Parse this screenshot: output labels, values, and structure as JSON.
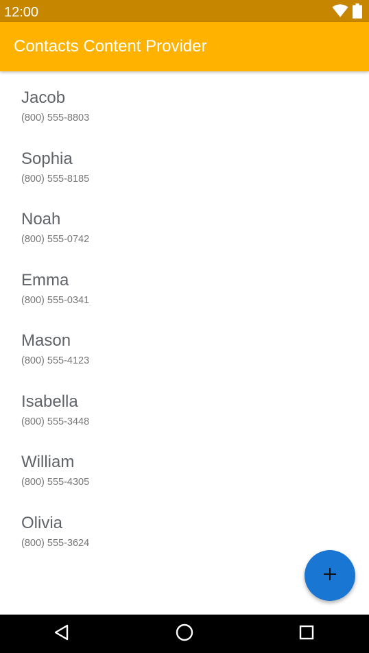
{
  "status_bar": {
    "time": "12:00",
    "icons": [
      "wifi-icon",
      "battery-icon"
    ],
    "color": "#C68600"
  },
  "app_bar": {
    "title": "Contacts Content Provider",
    "color": "#FFB300"
  },
  "contacts": [
    {
      "name": "Jacob",
      "phone": "(800) 555-8803"
    },
    {
      "name": "Sophia",
      "phone": "(800) 555-8185"
    },
    {
      "name": "Noah",
      "phone": "(800) 555-0742"
    },
    {
      "name": "Emma",
      "phone": "(800) 555-0341"
    },
    {
      "name": "Mason",
      "phone": "(800) 555-4123"
    },
    {
      "name": "Isabella",
      "phone": "(800) 555-3448"
    },
    {
      "name": "William",
      "phone": "(800) 555-4305"
    },
    {
      "name": "Olivia",
      "phone": "(800) 555-3624"
    }
  ],
  "fab": {
    "icon": "plus-icon",
    "color": "#1976D2"
  },
  "nav_bar": {
    "buttons": [
      "back-icon",
      "home-icon",
      "recents-icon"
    ]
  }
}
